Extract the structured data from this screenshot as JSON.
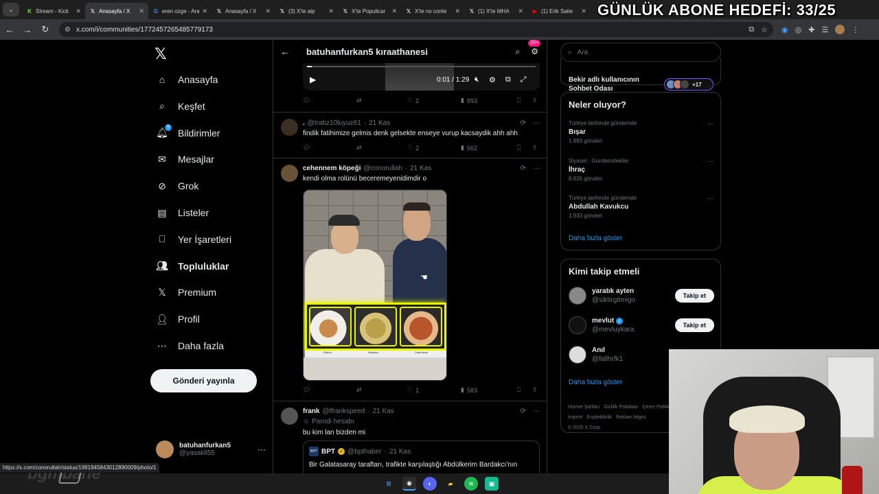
{
  "overlay": {
    "goal_text": "GÜNLÜK ABONE HEDEFİ: 33/25"
  },
  "browser": {
    "tabs": [
      {
        "title": "Stream - Kick",
        "icon": "kick-icon",
        "color": "#53fc18"
      },
      {
        "title": "Anasayfa / X",
        "icon": "x-icon",
        "color": "#ffffff"
      },
      {
        "title": "eren ozge - Ara",
        "icon": "google-icon",
        "color": "#4285f4"
      },
      {
        "title": "Anasayfa / X",
        "icon": "x-icon",
        "color": "#ffffff"
      },
      {
        "title": "(3) X'te alp",
        "icon": "x-icon",
        "color": "#ffffff"
      },
      {
        "title": "X'te Populicar",
        "icon": "x-icon",
        "color": "#ffffff"
      },
      {
        "title": "X'te no conte",
        "icon": "x-icon",
        "color": "#ffffff"
      },
      {
        "title": "(1) X'te MHA",
        "icon": "x-icon",
        "color": "#ffffff"
      },
      {
        "title": "(1) Erik Satie",
        "icon": "youtube-icon",
        "color": "#ff0000"
      }
    ],
    "url": "x.com/i/communities/1772457265485779173"
  },
  "nav": {
    "items": [
      {
        "label": "Anasayfa",
        "icon": "home-icon",
        "bold": false
      },
      {
        "label": "Keşfet",
        "icon": "search-icon",
        "bold": false
      },
      {
        "label": "Bildirimler",
        "icon": "bell-icon",
        "badge": "5",
        "bold": false
      },
      {
        "label": "Mesajlar",
        "icon": "mail-icon",
        "bold": false
      },
      {
        "label": "Grok",
        "icon": "grok-icon",
        "bold": false
      },
      {
        "label": "Listeler",
        "icon": "list-icon",
        "bold": false
      },
      {
        "label": "Yer İşaretleri",
        "icon": "bookmark-icon",
        "bold": false
      },
      {
        "label": "Topluluklar",
        "icon": "communities-icon",
        "bold": true
      },
      {
        "label": "Premium",
        "icon": "x-icon",
        "bold": false
      },
      {
        "label": "Profil",
        "icon": "profile-icon",
        "bold": false
      },
      {
        "label": "Daha fazla",
        "icon": "more-circle-icon",
        "bold": false
      }
    ],
    "post_button": "Gönderi yayınla",
    "account": {
      "name": "batuhanfurkan5",
      "handle": "@yasakli55"
    }
  },
  "main": {
    "title": "batuhanfurkan5 kıraathanesi",
    "header_badge": "20+",
    "video": {
      "time": "0:01 / 1:29",
      "progress": 0.02
    },
    "top_actions": {
      "replies": "",
      "reposts": "",
      "likes": "2",
      "views": "893"
    },
    "tweets": [
      {
        "name": ".",
        "handle": "@trabz10luyuz61",
        "date": "21 Kas",
        "text": "findik fatihimize gelmis denk gelsekte enseye vurup kacsaydik ahh ahh",
        "actions": {
          "replies": "",
          "reposts": "",
          "likes": "2",
          "views": "562"
        }
      },
      {
        "name": "cehennem köpeği",
        "handle": "@conorullah",
        "date": "21 Kas",
        "text": "kendi olma rolünü beceremeyenidimdir o",
        "media_captions": [
          "Dürüm",
          "Baklava",
          "Lahmacun"
        ],
        "actions": {
          "replies": "",
          "reposts": "",
          "likes": "1",
          "views": "583"
        }
      },
      {
        "name": "frank",
        "handle": "@lfrankspeed",
        "date": "21 Kas",
        "parody": "Parodi hesabı",
        "text": "bu kim lan bizden mi",
        "quote": {
          "avatar_text": "BPT",
          "name": "BPT",
          "handle": "@bpthaber",
          "date": "21 Kas",
          "text": "Bir Galatasaray taraftarı, trafikte karşılaştığı Abdülkerim Bardakcı'nın"
        }
      }
    ]
  },
  "right": {
    "search_placeholder": "Ara",
    "chat": {
      "title": "Bekir adlı kullanıcının Sohbet Odası",
      "count": "+17"
    },
    "trends_title": "Neler oluyor?",
    "trends": [
      {
        "context": "Türkiye tarihinde gündemde",
        "name": "Bışar",
        "count": "1.993 gönderi"
      },
      {
        "context": "Siyaset · Gündemdekiler",
        "name": "İhraç",
        "count": "8.926 gönderi"
      },
      {
        "context": "Türkiye tarihinde gündemde",
        "name": "Abdullah Kavukcu",
        "count": "1.933 gönderi"
      }
    ],
    "show_more": "Daha fazla göster",
    "follow_title": "Kimi takip etmeli",
    "follow": [
      {
        "name": "yaratık ayten",
        "handle": "@siktirgitmigo",
        "verified": false,
        "button": "Takip et"
      },
      {
        "name": "mevlut",
        "handle": "@mevluykara",
        "verified": true,
        "button": "Takip et"
      },
      {
        "name": "Anıl",
        "handle": "@fallhrfk1",
        "verified": false,
        "button": ""
      }
    ],
    "show_more_2": "Daha fazla göster",
    "footer": [
      "Hizmet Şartları",
      "Gizlilik Politikası",
      "Çerez Politikası",
      "İmprint",
      "Erişilebilirlik",
      "Reklam bilgisi",
      "© 2025 X Corp."
    ]
  },
  "status_url": "https://x.com/conorullah/status/1991945843012890009/photo/1",
  "watermark": "bgmbane"
}
